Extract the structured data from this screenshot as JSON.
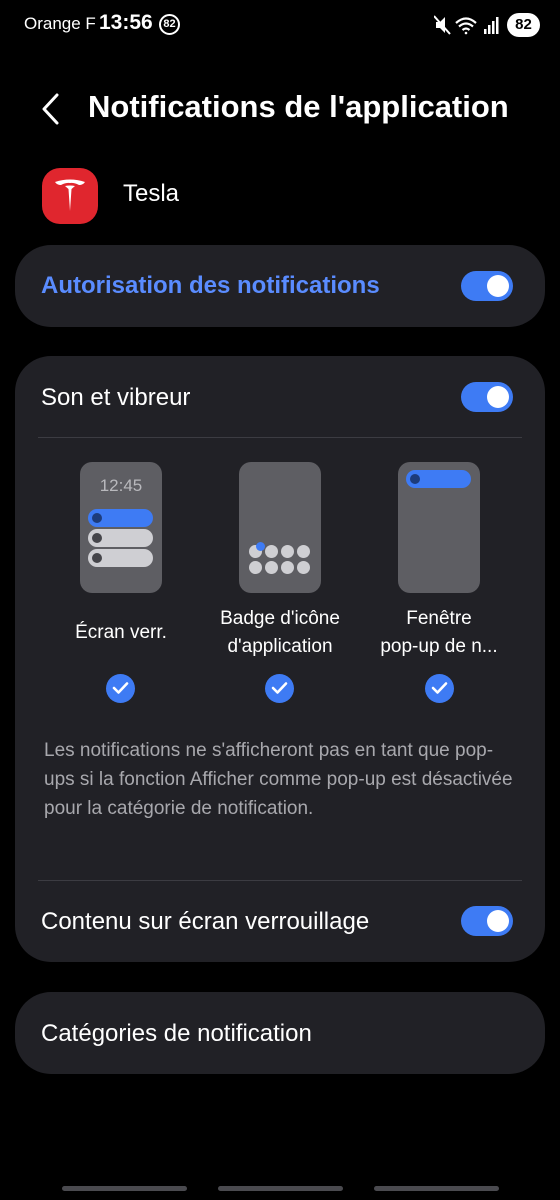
{
  "status_bar": {
    "carrier": "Orange F",
    "time": "13:56",
    "notification_count": "82",
    "battery": "82"
  },
  "header": {
    "title": "Notifications de l'application"
  },
  "app": {
    "name": "Tesla"
  },
  "allow": {
    "label": "Autorisation des notifications",
    "enabled": true
  },
  "sound": {
    "label": "Son et vibreur",
    "enabled": true
  },
  "styles": [
    {
      "preview_text": "12:45",
      "label_line1": "Écran verr.",
      "label_line2": "",
      "checked": true
    },
    {
      "label_line1": "Badge d'icône",
      "label_line2": "d'application",
      "checked": true
    },
    {
      "label_line1": "Fenêtre",
      "label_line2": "pop-up de n...",
      "checked": true
    }
  ],
  "info_text": "Les notifications ne s'afficheront pas en tant que pop-ups si la fonction Afficher comme pop-up est désactivée pour la catégorie de notification.",
  "lock_content": {
    "label": "Contenu sur écran verrouillage",
    "enabled": true
  },
  "categories": {
    "label": "Catégories de notification"
  },
  "colors": {
    "accent": "#3e7bf4",
    "accent_text": "#5a8cff",
    "card": "#212126",
    "background": "#000000",
    "tesla_red": "#e0262e"
  }
}
